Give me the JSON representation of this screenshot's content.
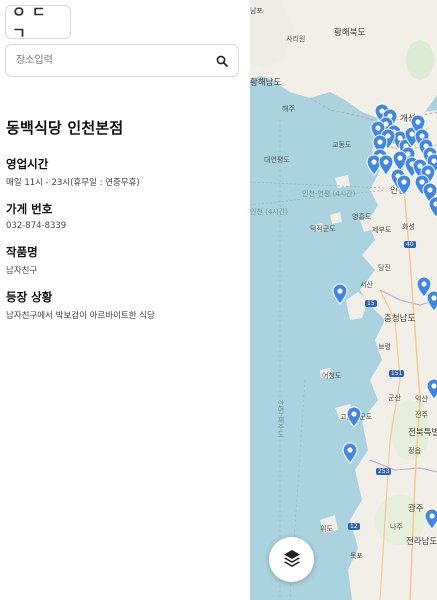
{
  "app": {
    "logo_text": "ㅇㄷㄱ"
  },
  "search": {
    "placeholder": "장소입력",
    "icon": "search-icon"
  },
  "detail": {
    "title": "동백식당 인천본점",
    "fields": [
      {
        "label": "영업시간",
        "value": "매일 11시 - 23시(휴무일 : 연중무휴)"
      },
      {
        "label": "가게 번호",
        "value": "032-874-8339"
      },
      {
        "label": "작품명",
        "value": "남자친구"
      },
      {
        "label": "등장 상황",
        "value": "남자친구에서 박보검이 아르바이트한 식당"
      }
    ]
  },
  "map": {
    "labels": {
      "l1": "남포",
      "l2": "황해북도",
      "l3": "사리원",
      "l4": "황해남도",
      "l5": "해주",
      "l6": "개성",
      "l7": "교동도",
      "l8": "대연평도",
      "l9": "인천",
      "l10": "인천-연평 (4시간)",
      "l11": "인천 (4시간)",
      "l12": "영흥도",
      "l13": "덕적군도",
      "l14": "제부도",
      "l15": "화성",
      "l16": "당진",
      "l17": "서산",
      "l18": "충청남도",
      "l19": "보령",
      "l20": "어청도",
      "l21": "군산",
      "l22": "익산",
      "l23": "전북특별",
      "l24": "고군산군도",
      "l25": "정읍",
      "l26": "광주",
      "l27": "나주",
      "l28": "전라남도",
      "l29": "목포",
      "l30": "위도",
      "l31": "안면-제주도",
      "l32": "전주"
    },
    "roads": {
      "r1": "15",
      "r2": "151",
      "r3": "40",
      "r4": "253",
      "r5": "12"
    },
    "colors": {
      "water": "#aad3df",
      "land": "#f2efe9",
      "marker": "#3f86e6",
      "border": "#b8a9c9"
    }
  },
  "layers_button": {
    "icon": "layers-icon"
  }
}
